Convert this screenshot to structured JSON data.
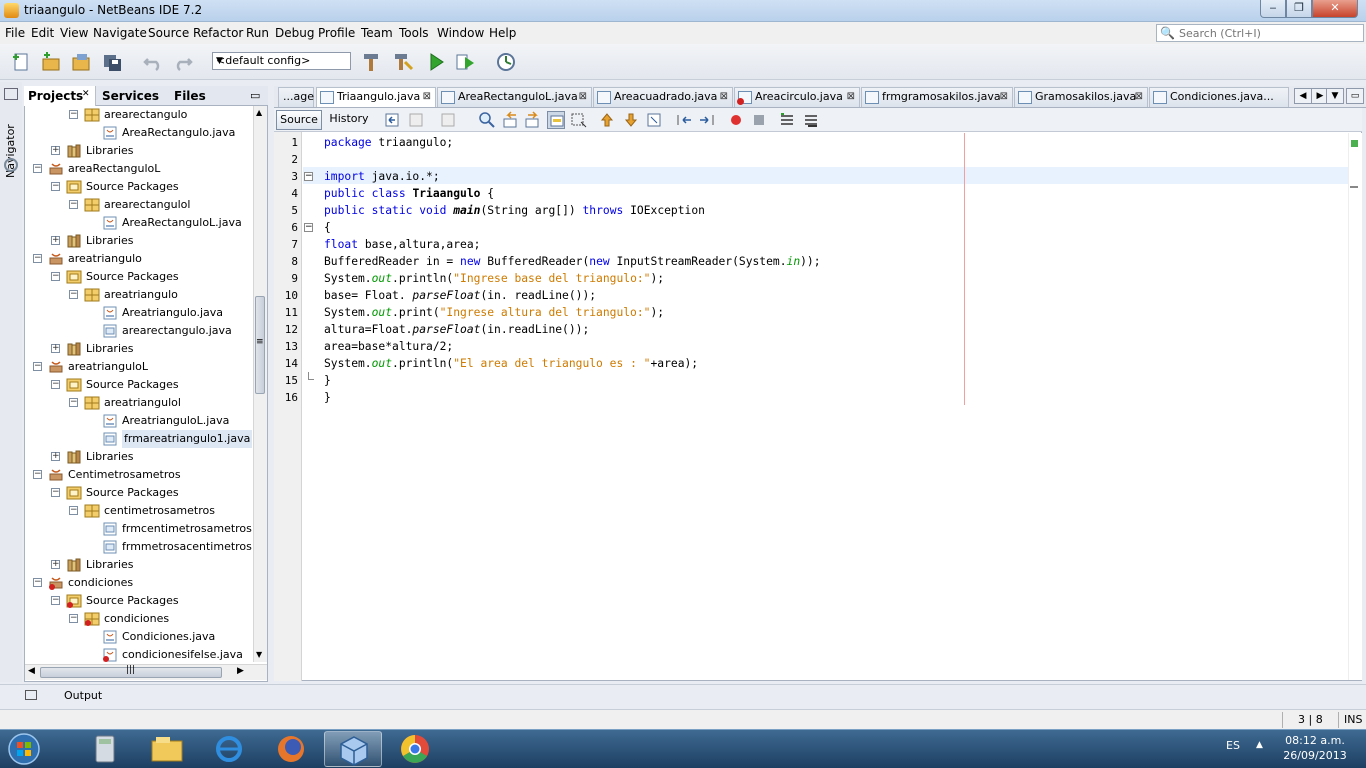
{
  "window": {
    "title": "triaangulo - NetBeans IDE 7.2",
    "min": "‒",
    "max": "❐",
    "close": "✕"
  },
  "menu": [
    "File",
    "Edit",
    "View",
    "Navigate",
    "Source",
    "Refactor",
    "Run",
    "Debug",
    "Profile",
    "Team",
    "Tools",
    "Window",
    "Help"
  ],
  "search": {
    "placeholder": "Search (Ctrl+I)"
  },
  "toolbar": {
    "config": "<default config>"
  },
  "navigator": {
    "label": "Navigator"
  },
  "projects_panel": {
    "tabs": [
      "Projects",
      "Services",
      "Files"
    ],
    "close": "✕",
    "minimize": "▭",
    "tree": [
      {
        "label": "arearectangulo",
        "kind": "package",
        "level": 2,
        "toggle": "−"
      },
      {
        "label": "AreaRectangulo.java",
        "kind": "java",
        "level": 3
      },
      {
        "label": "Libraries",
        "kind": "libraries",
        "level": 1,
        "toggle": "+"
      },
      {
        "label": "areaRectanguloL",
        "kind": "project",
        "level": 0,
        "toggle": "−"
      },
      {
        "label": "Source Packages",
        "kind": "srcpkg",
        "level": 1,
        "toggle": "−"
      },
      {
        "label": "arearectangulol",
        "kind": "package",
        "level": 2,
        "toggle": "−"
      },
      {
        "label": "AreaRectanguloL.java",
        "kind": "java",
        "level": 3
      },
      {
        "label": "Libraries",
        "kind": "libraries",
        "level": 1,
        "toggle": "+"
      },
      {
        "label": "areatriangulo",
        "kind": "project",
        "level": 0,
        "toggle": "−"
      },
      {
        "label": "Source Packages",
        "kind": "srcpkg",
        "level": 1,
        "toggle": "−"
      },
      {
        "label": "areatriangulo",
        "kind": "package",
        "level": 2,
        "toggle": "−"
      },
      {
        "label": "Areatriangulo.java",
        "kind": "java",
        "level": 3
      },
      {
        "label": "arearectangulo.java",
        "kind": "form",
        "level": 3
      },
      {
        "label": "Libraries",
        "kind": "libraries",
        "level": 1,
        "toggle": "+"
      },
      {
        "label": "areatrianguloL",
        "kind": "project",
        "level": 0,
        "toggle": "−"
      },
      {
        "label": "Source Packages",
        "kind": "srcpkg",
        "level": 1,
        "toggle": "−"
      },
      {
        "label": "areatriangulol",
        "kind": "package",
        "level": 2,
        "toggle": "−"
      },
      {
        "label": "AreatrianguloL.java",
        "kind": "java",
        "level": 3
      },
      {
        "label": "frmareatriangulo1.java",
        "kind": "form",
        "level": 3,
        "selected": true
      },
      {
        "label": "Libraries",
        "kind": "libraries",
        "level": 1,
        "toggle": "+"
      },
      {
        "label": "Centimetrosametros",
        "kind": "project",
        "level": 0,
        "toggle": "−"
      },
      {
        "label": "Source Packages",
        "kind": "srcpkg",
        "level": 1,
        "toggle": "−"
      },
      {
        "label": "centimetrosametros",
        "kind": "package",
        "level": 2,
        "toggle": "−"
      },
      {
        "label": "frmcentimetrosametros.ja",
        "kind": "form",
        "level": 3
      },
      {
        "label": "frmmetrosacentimetros.ja",
        "kind": "form",
        "level": 3
      },
      {
        "label": "Libraries",
        "kind": "libraries",
        "level": 1,
        "toggle": "+"
      },
      {
        "label": "condiciones",
        "kind": "project-err",
        "level": 0,
        "toggle": "−"
      },
      {
        "label": "Source Packages",
        "kind": "srcpkg-err",
        "level": 1,
        "toggle": "−"
      },
      {
        "label": "condiciones",
        "kind": "package-err",
        "level": 2,
        "toggle": "−"
      },
      {
        "label": "Condiciones.java",
        "kind": "java",
        "level": 3
      },
      {
        "label": "condicionesifelse.java",
        "kind": "java-err",
        "level": 3
      }
    ],
    "hscroll_thumb": "|||",
    "vscroll_grip": "≡"
  },
  "editor_tabs": [
    {
      "label": "...age",
      "x": 0
    },
    {
      "label": "Triaangulo.java",
      "active": true
    },
    {
      "label": "AreaRectanguloL.java"
    },
    {
      "label": "Areacuadrado.java"
    },
    {
      "label": "Areacirculo.java",
      "error": true
    },
    {
      "label": "frmgramosakilos.java"
    },
    {
      "label": "Gramosakilos.java"
    },
    {
      "label": "Condiciones.java..."
    }
  ],
  "editor_nav": {
    "left": "◀",
    "right": "▶",
    "down": "▼",
    "restore": "▭"
  },
  "editor_toolbar": {
    "source": "Source",
    "history": "History"
  },
  "code": {
    "line_numbers": [
      "1",
      "2",
      "3",
      "4",
      "5",
      "6",
      "7",
      "8",
      "9",
      "10",
      "11",
      "12",
      "13",
      "14",
      "15",
      "16"
    ],
    "lines": [
      [
        {
          "t": "package",
          "c": "kw"
        },
        {
          "t": " triaangulo;"
        }
      ],
      [],
      [
        {
          "t": "import",
          "c": "kw"
        },
        {
          "t": " java.io.*;"
        }
      ],
      [
        {
          "t": "public class",
          "c": "kw"
        },
        {
          "t": " "
        },
        {
          "t": "Triaangulo",
          "c": "bold"
        },
        {
          "t": " {"
        }
      ],
      [
        {
          "t": "public static void",
          "c": "kw"
        },
        {
          "t": " "
        },
        {
          "t": "main",
          "c": "bold stm"
        },
        {
          "t": "(String arg[]) "
        },
        {
          "t": "throws",
          "c": "kw"
        },
        {
          "t": " IOException"
        }
      ],
      [
        {
          "t": "{"
        }
      ],
      [
        {
          "t": "float",
          "c": "kw"
        },
        {
          "t": " base,altura,area;"
        }
      ],
      [
        {
          "t": "BufferedReader in = "
        },
        {
          "t": "new",
          "c": "kw"
        },
        {
          "t": " BufferedReader("
        },
        {
          "t": "new",
          "c": "kw"
        },
        {
          "t": " InputStreamReader(System."
        },
        {
          "t": "in",
          "c": "fld"
        },
        {
          "t": "));"
        }
      ],
      [
        {
          "t": "System."
        },
        {
          "t": "out",
          "c": "fld"
        },
        {
          "t": ".println("
        },
        {
          "t": "\"Ingrese base del triangulo:\"",
          "c": "str"
        },
        {
          "t": ");"
        }
      ],
      [
        {
          "t": "base= Float. "
        },
        {
          "t": "parseFloat",
          "c": "stm"
        },
        {
          "t": "(in. readLine());"
        }
      ],
      [
        {
          "t": "System."
        },
        {
          "t": "out",
          "c": "fld"
        },
        {
          "t": ".print("
        },
        {
          "t": "\"Ingrese altura del triangulo:\"",
          "c": "str"
        },
        {
          "t": ");"
        }
      ],
      [
        {
          "t": "altura=Float."
        },
        {
          "t": "parseFloat",
          "c": "stm"
        },
        {
          "t": "(in.readLine());"
        }
      ],
      [
        {
          "t": "area=base*altura/2;"
        }
      ],
      [
        {
          "t": "System."
        },
        {
          "t": "out",
          "c": "fld"
        },
        {
          "t": ".println("
        },
        {
          "t": "\"El area del triangulo es : \"",
          "c": "str"
        },
        {
          "t": "+area);"
        }
      ],
      [
        {
          "t": "}"
        }
      ],
      [
        {
          "t": "}"
        }
      ]
    ],
    "fold_lines": [
      3,
      6
    ],
    "fold_end_line": 15
  },
  "output": {
    "label": "Output"
  },
  "status": {
    "position": "3 | 8",
    "mode": "INS"
  },
  "taskbar": {
    "lang": "ES",
    "tray_up": "▲",
    "time": "08:12 a.m.",
    "date": "26/09/2013"
  }
}
